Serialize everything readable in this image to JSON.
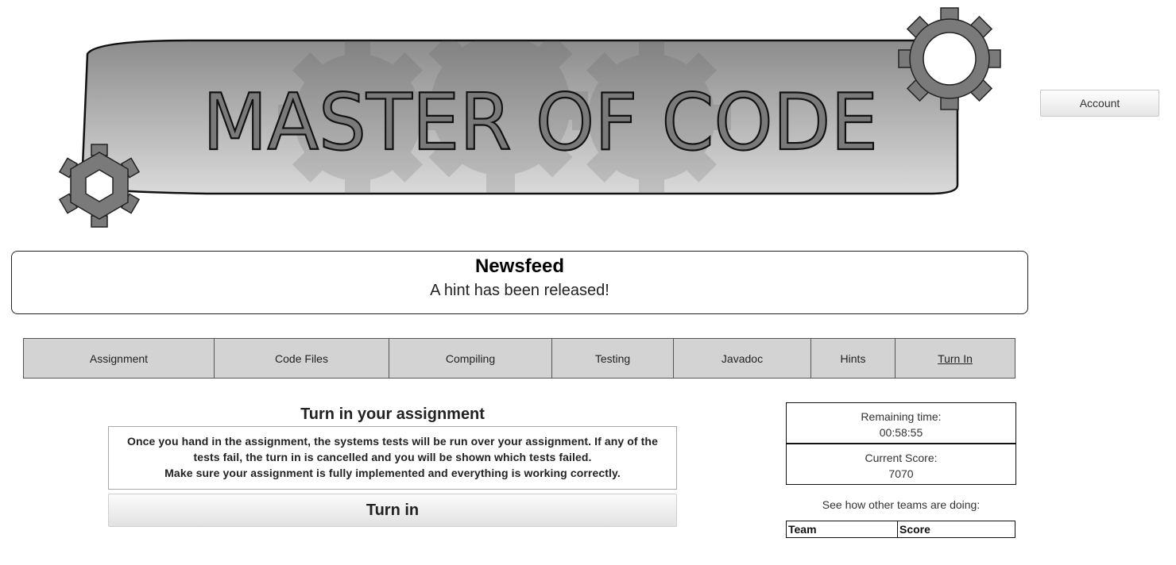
{
  "banner": {
    "title": "MASTER OF CODE"
  },
  "account": {
    "label": "Account"
  },
  "newsfeed": {
    "title": "Newsfeed",
    "message": "A hint has been released!"
  },
  "tabs": [
    {
      "label": "Assignment"
    },
    {
      "label": "Code Files"
    },
    {
      "label": "Compiling"
    },
    {
      "label": "Testing"
    },
    {
      "label": "Javadoc"
    },
    {
      "label": "Hints"
    },
    {
      "label": "Turn In",
      "active": true
    }
  ],
  "turnin": {
    "heading": "Turn in your assignment",
    "info_line1": "Once you hand in the assignment, the systems tests will be run over your assignment. If any of the",
    "info_line2": "tests fail, the turn in is cancelled and you will be shown which tests failed.",
    "info_line3": "Make sure your assignment is fully implemented and everything is working correctly.",
    "button_label": "Turn in"
  },
  "stats": {
    "remaining_label": "Remaining time:",
    "remaining_value": "00:58:55",
    "score_label": "Current Score:",
    "score_value": "7070"
  },
  "teams": {
    "prompt": "See how other teams are doing:",
    "headers": [
      "Team",
      "Score"
    ]
  },
  "colors": {
    "tab_bg": "#d3d3d3",
    "gear": "#7a7a7a",
    "banner_top": "#8c8c8c",
    "banner_bottom": "#d9d9d9"
  }
}
